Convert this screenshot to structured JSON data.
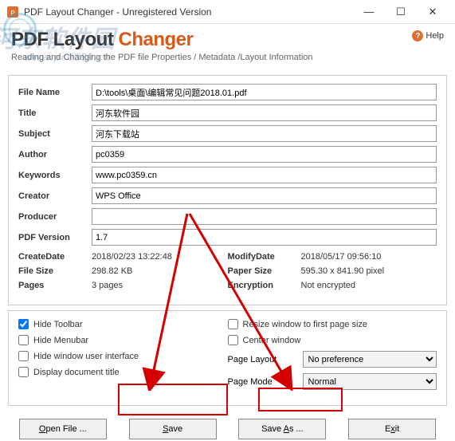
{
  "window": {
    "title": "PDF Layout Changer - Unregistered Version"
  },
  "watermark": {
    "text": "河东软件园",
    "url": "www.pc0359.cn"
  },
  "header": {
    "logo_plain": "PDF Layout ",
    "logo_accent": "Changer",
    "subtitle": "Reading and Changing the PDF file Properties / Metadata /Layout Information",
    "help": "Help"
  },
  "labels": {
    "file_name": "File Name",
    "title": "Title",
    "subject": "Subject",
    "author": "Author",
    "keywords": "Keywords",
    "creator": "Creator",
    "producer": "Producer",
    "pdf_version": "PDF Version",
    "create_date": "CreateDate",
    "file_size": "File Size",
    "pages": "Pages",
    "modify_date": "ModifyDate",
    "paper_size": "Paper Size",
    "encryption": "Encryption"
  },
  "values": {
    "file_name": "D:\\tools\\桌面\\编辑常见问题2018.01.pdf",
    "title": "河东软件园",
    "subject": "河东下载站",
    "author": "pc0359",
    "keywords": "www.pc0359.cn",
    "creator": "WPS Office",
    "producer": "",
    "pdf_version": "1.7",
    "create_date": "2018/02/23 13:22:48",
    "file_size": "298.82 KB",
    "pages": "3 pages",
    "modify_date": "2018/05/17 09:56:10",
    "paper_size": "595.30 x 841.90 pixel",
    "encryption": "Not encrypted"
  },
  "options": {
    "hide_toolbar": "Hide Toolbar",
    "hide_menubar": "Hide Menubar",
    "hide_window_ui": "Hide window user interface",
    "display_doc_title": "Display document title",
    "resize_window": "Resize window to first page size",
    "center_window": "Center window",
    "page_layout": "Page Layout",
    "page_mode": "Page Mode"
  },
  "selects": {
    "page_layout_value": "No preference",
    "page_mode_value": "Normal"
  },
  "buttons": {
    "open": "Open File ...",
    "save": "Save",
    "save_as": "Save As ...",
    "exit": "Exit"
  }
}
